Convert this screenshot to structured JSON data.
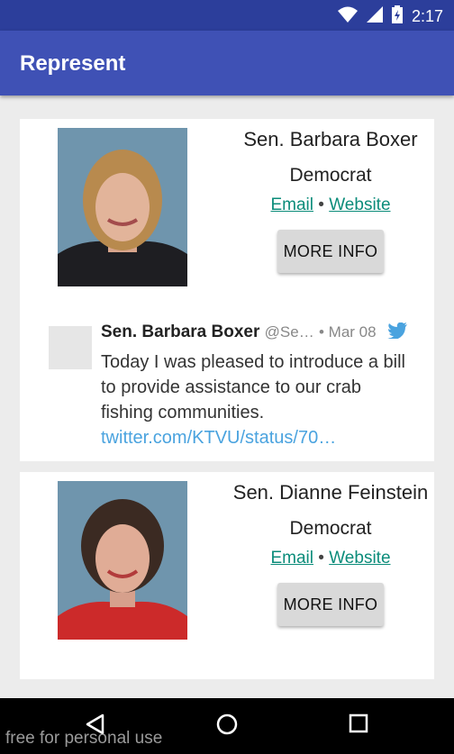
{
  "status_bar": {
    "time": "2:17"
  },
  "app_bar": {
    "title": "Represent"
  },
  "representatives": [
    {
      "name": "Sen. Barbara Boxer",
      "party": "Democrat",
      "email_label": "Email",
      "separator": "•",
      "website_label": "Website",
      "more_info_label": "MORE INFO",
      "tweet": {
        "author": "Sen. Barbara Boxer",
        "handle": "@Se…",
        "date": "• Mar 08",
        "text": "Today I was pleased to introduce a bill to provide assistance to our crab fishing communities.",
        "link": "twitter.com/KTVU/status/70…"
      }
    },
    {
      "name": "Sen. Dianne Feinstein",
      "party": "Democrat",
      "email_label": "Email",
      "separator": "•",
      "website_label": "Website",
      "more_info_label": "MORE INFO"
    }
  ],
  "watermark": "free for personal use",
  "colors": {
    "primary": "#3f51b5",
    "primary_dark": "#2c3e9b",
    "link": "#0b8c7a",
    "twitter": "#4aa3df"
  }
}
